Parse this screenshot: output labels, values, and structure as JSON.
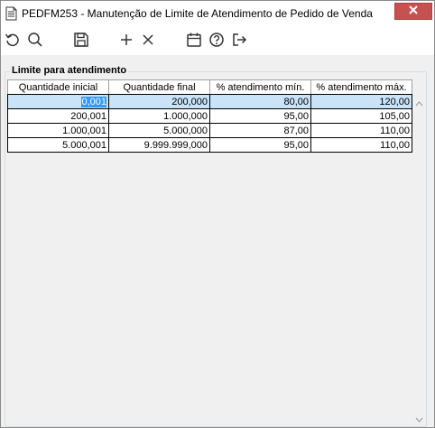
{
  "window": {
    "title": "PEDFM253 - Manutenção de Limite de Atendimento de Pedido de Venda"
  },
  "icons": {
    "window": "document-icon",
    "close": "close-icon",
    "toolbar": [
      "refresh-icon",
      "search-icon",
      "save-icon",
      "add-icon",
      "delete-icon",
      "calendar-icon",
      "help-icon",
      "exit-icon"
    ]
  },
  "group": {
    "label": "Limite para atendimento"
  },
  "table": {
    "columns": [
      "Quantidade inicial",
      "Quantidade final",
      "% atendimento mín.",
      "% atendimento máx."
    ],
    "rows": [
      [
        "0,001",
        "200,000",
        "80,00",
        "120,00"
      ],
      [
        "200,001",
        "1.000,000",
        "95,00",
        "105,00"
      ],
      [
        "1.000,001",
        "5.000,000",
        "87,00",
        "110,00"
      ],
      [
        "5.000,001",
        "9.999.999,000",
        "95,00",
        "110,00"
      ]
    ]
  },
  "colors": {
    "close_button": "#c75050",
    "selected_row": "#c9e4f9",
    "selected_cell": "#3399ff"
  }
}
